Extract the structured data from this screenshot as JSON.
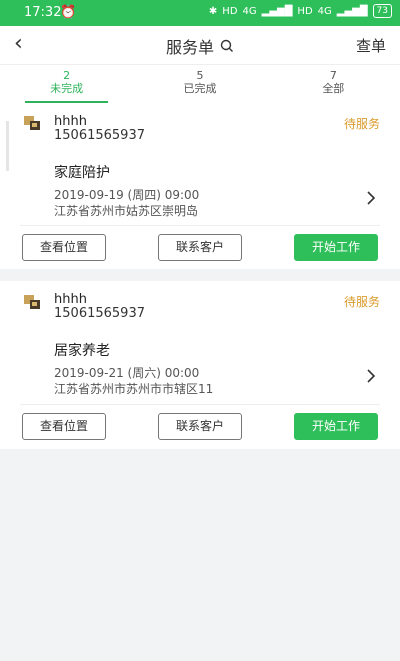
{
  "statusbar": {
    "time": "17:32",
    "alarm_icon": "alarm-clock-icon",
    "bluetooth_icon": "bluetooth-icon",
    "hd1": "HD",
    "net": "4G",
    "hd2": "HD",
    "net2": "4G",
    "battery": "73"
  },
  "header": {
    "title": "服务单",
    "search_icon": "search-icon",
    "right_action": "查单",
    "back_icon": "back-arrow-icon"
  },
  "tabs": [
    {
      "count": "2",
      "label": "未完成",
      "active": true
    },
    {
      "count": "5",
      "label": "已完成",
      "active": false
    },
    {
      "count": "7",
      "label": "全部",
      "active": false
    }
  ],
  "orders": [
    {
      "name": "hhhh",
      "phone": "15061565937",
      "status": "待服务",
      "service": "家庭陪护",
      "datetime": "2019-09-19 (周四) 09:00",
      "address": "江苏省苏州市姑苏区崇明岛",
      "actions": {
        "location": "查看位置",
        "contact": "联系客户",
        "start": "开始工作"
      }
    },
    {
      "name": "hhhh",
      "phone": "15061565937",
      "status": "待服务",
      "service": "居家养老",
      "datetime": "2019-09-21 (周六) 00:00",
      "address": "江苏省苏州市苏州市市辖区11",
      "actions": {
        "location": "查看位置",
        "contact": "联系客户",
        "start": "开始工作"
      }
    }
  ],
  "colors": {
    "accent": "#2fbf5a",
    "status": "#d99a2b"
  }
}
